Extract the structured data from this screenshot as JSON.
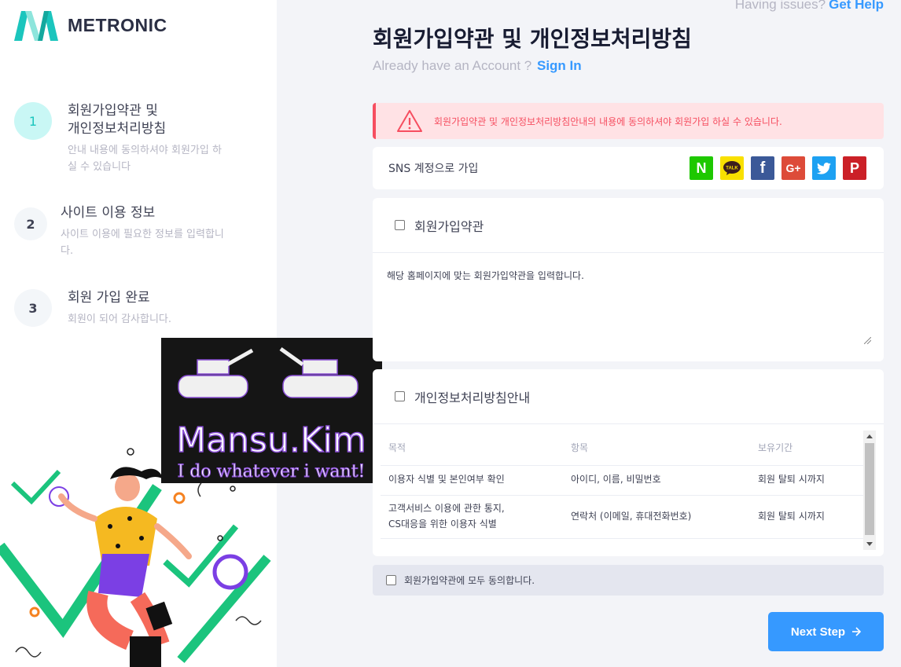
{
  "brand": {
    "name": "METRONIC"
  },
  "topbar": {
    "question": "Having issues?",
    "link": "Get Help"
  },
  "header": {
    "title": "회원가입약관 및 개인정보처리방침",
    "account_question": "Already have an Account ?",
    "sign_in": "Sign In"
  },
  "steps": [
    {
      "num": "1",
      "title_line1": "회원가입약관 및",
      "title_line2": "개인정보처리방침",
      "desc": "안내 내용에 동의하셔야 회원가입 하실 수 있습니다"
    },
    {
      "num": "2",
      "title": "사이트 이용 정보",
      "desc": "사이트 이용에 필요한 정보를 입력합니다."
    },
    {
      "num": "3",
      "title": "회원 가입 완료",
      "desc": "회원이 되어 감사합니다."
    }
  ],
  "alert": {
    "text": "회원가입약관 및 개인정보처리방침안내의 내용에 동의하셔야 회원가입 하실 수 있습니다."
  },
  "sns": {
    "label": "SNS 계정으로 가입",
    "buttons": [
      {
        "name": "naver",
        "glyph": "N",
        "color": "#1ec800"
      },
      {
        "name": "kakao",
        "glyph": "TALK",
        "color": "#f9e000"
      },
      {
        "name": "facebook",
        "glyph": "f",
        "color": "#3b5998"
      },
      {
        "name": "google-plus",
        "glyph": "G+",
        "color": "#dd4b39"
      },
      {
        "name": "twitter",
        "glyph": "t",
        "color": "#1da1f2"
      },
      {
        "name": "pinterest",
        "glyph": "P",
        "color": "#cb2027"
      }
    ]
  },
  "terms": {
    "label": "회원가입약관",
    "content": "해당 홈페이지에 맞는 회원가입약관을 입력합니다."
  },
  "privacy": {
    "label": "개인정보처리방침안내",
    "headers": [
      "목적",
      "항목",
      "보유기간"
    ],
    "rows": [
      {
        "purpose": "이용자 식별 및 본인여부 확인",
        "item": "아이디, 이름, 비밀번호",
        "period": "회원 탈퇴 시까지"
      },
      {
        "purpose_line1": "고객서비스 이용에 관한 통지,",
        "purpose_line2": "CS대응을 위한 이용자 식별",
        "item": "연락처 (이메일, 휴대전화번호)",
        "period": "회원 탈퇴 시까지"
      }
    ]
  },
  "agree_all": {
    "label": "회원가입약관에 모두 동의합니다."
  },
  "next_button": {
    "label": "Next Step"
  },
  "watermark": {
    "name": "Mansu.Kim",
    "tagline": "I do whatever i want!"
  },
  "colors": {
    "primary": "#3699ff",
    "success_light": "#c9f7f5",
    "danger": "#f64e60",
    "danger_light": "#ffe2e5"
  }
}
